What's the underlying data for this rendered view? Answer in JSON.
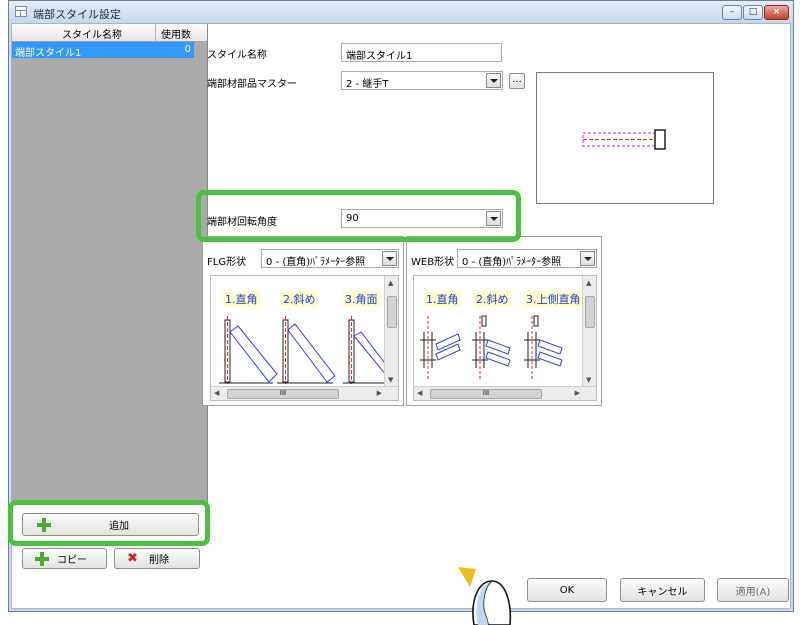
{
  "window": {
    "title": "端部スタイル設定",
    "minimize": "–",
    "maximize": "□",
    "close": "×"
  },
  "style_list": {
    "columns": [
      "スタイル名称",
      "使用数"
    ],
    "rows": [
      {
        "name": "端部スタイル1",
        "count": "0",
        "selected": true
      }
    ]
  },
  "left_buttons": {
    "add": "追加",
    "copy": "コピー",
    "delete": "削除"
  },
  "form": {
    "style_name_label": "スタイル名称",
    "style_name_value": "端部スタイル1",
    "parts_master_label": "端部材部品マスター",
    "parts_master_value": "2 - 継手T",
    "ellipsis": "...",
    "rotation_label": "端部材回転角度",
    "rotation_value": "90"
  },
  "flg": {
    "label": "FLG形状",
    "value": "0 - (直角)ﾊﾟﾗﾒｰﾀｰ参照",
    "shapes": [
      "1.直角",
      "2.斜め",
      "3.角面"
    ],
    "scroll_dots": "III"
  },
  "web": {
    "label": "WEB形状",
    "value": "0 - (直角)ﾊﾟﾗﾒｰﾀｰ参照",
    "shapes": [
      "1.直角",
      "2.斜め",
      "3.上側直角"
    ],
    "scroll_dots": "III"
  },
  "dialog_buttons": {
    "ok": "OK",
    "cancel": "キャンセル",
    "apply": "適用(A)"
  },
  "colors": {
    "highlight_green": "#4ac13f",
    "selection_blue": "#3399ff",
    "list_gray": "#ababab"
  }
}
